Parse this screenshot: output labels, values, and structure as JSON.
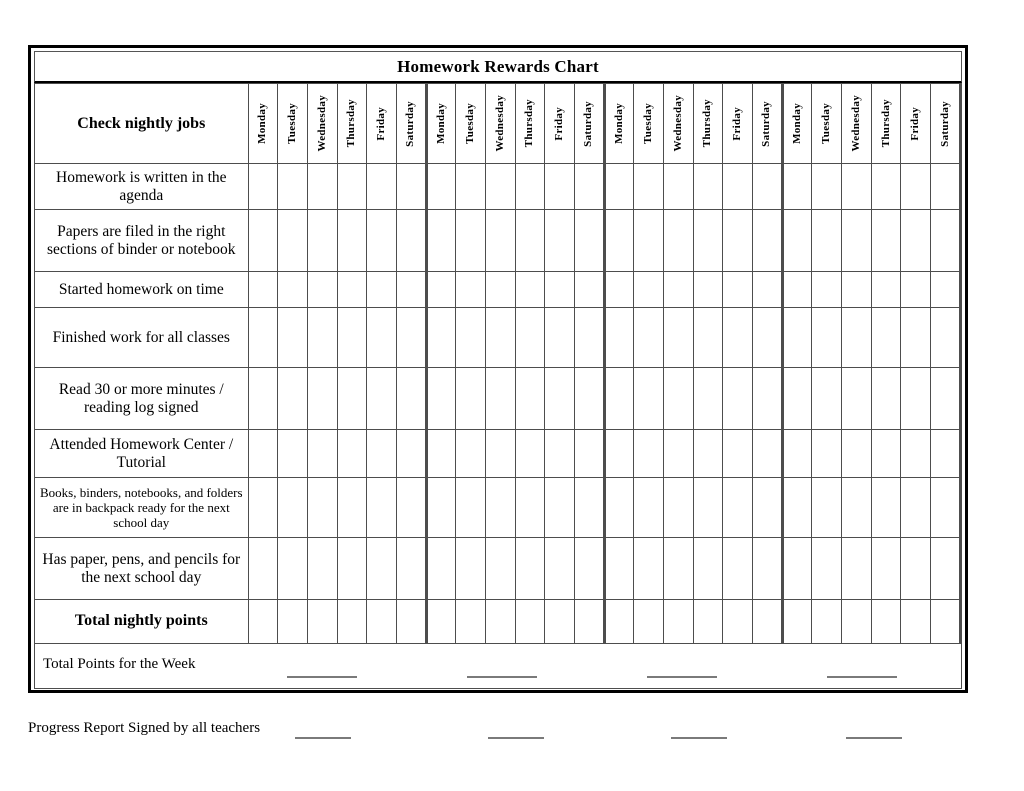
{
  "document": {
    "title": "Homework Rewards Chart"
  },
  "table": {
    "row_header_label": "Check nightly jobs",
    "weeks": 4,
    "days_per_week": 6,
    "day_columns": [
      "Monday",
      "Tuesday",
      "Wednesday",
      "Thursday",
      "Friday",
      "Saturday",
      "Monday",
      "Tuesday",
      "Wednesday",
      "Thursday",
      "Friday",
      "Saturday",
      "Monday",
      "Tuesday",
      "Wednesday",
      "Thursday",
      "Friday",
      "Saturday",
      "Monday",
      "Tuesday",
      "Wednesday",
      "Thursday",
      "Friday",
      "Saturday"
    ],
    "rows": [
      {
        "label": "Homework is written in the agenda",
        "style": "normal"
      },
      {
        "label": "Papers are filed in the right sections of binder or notebook",
        "style": "normal"
      },
      {
        "label": "Started homework on time",
        "style": "normal"
      },
      {
        "label": "Finished work for all classes",
        "style": "normal"
      },
      {
        "label": "Read 30 or more minutes / reading log signed",
        "style": "normal"
      },
      {
        "label": "Attended Homework Center / Tutorial",
        "style": "normal"
      },
      {
        "label": "Books, binders, notebooks, and folders are in backpack ready for the next school day",
        "style": "small"
      },
      {
        "label": "Has paper, pens, and pencils for the next school day",
        "style": "normal"
      },
      {
        "label": "Total nightly points",
        "style": "bold"
      }
    ]
  },
  "footer": {
    "total_points_label": "Total Points for the Week",
    "total_points_blanks": [
      "",
      "",
      "",
      ""
    ],
    "progress_report_label": "Progress Report Signed by all teachers",
    "progress_report_blanks": [
      "",
      "",
      "",
      ""
    ]
  },
  "colors": {
    "frame": "#000000",
    "grid_line": "#4d4d4d",
    "blank_line": "#7a7a7a",
    "background": "#ffffff",
    "text": "#000000"
  }
}
